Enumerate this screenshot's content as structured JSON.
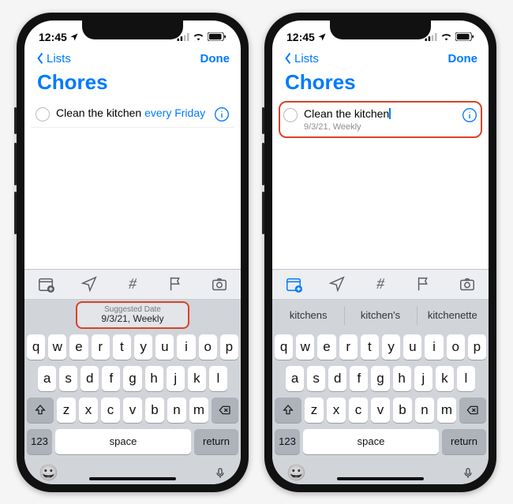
{
  "status": {
    "time": "12:45",
    "has_location_arrow": true
  },
  "nav": {
    "back": "Lists",
    "done": "Done"
  },
  "title": "Chores",
  "left": {
    "reminder_text_plain": "Clean the kitchen ",
    "reminder_text_nl": "every Friday",
    "suggest_label": "Suggested Date",
    "suggest_value": "9/3/21, Weekly"
  },
  "right": {
    "reminder_text": "Clean the kitchen",
    "reminder_sub": "9/3/21, Weekly",
    "predictions": [
      "kitchens",
      "kitchen's",
      "kitchenette"
    ]
  },
  "keyboard": {
    "row1": [
      "q",
      "w",
      "e",
      "r",
      "t",
      "y",
      "u",
      "i",
      "o",
      "p"
    ],
    "row2": [
      "a",
      "s",
      "d",
      "f",
      "g",
      "h",
      "j",
      "k",
      "l"
    ],
    "row3": [
      "z",
      "x",
      "c",
      "v",
      "b",
      "n",
      "m"
    ],
    "num": "123",
    "space": "space",
    "ret": "return"
  },
  "icons": {
    "calendar": "calendar-add-icon",
    "location": "location-arrow-icon",
    "hash": "hash-icon",
    "flag": "flag-icon",
    "camera": "camera-icon",
    "info": "info-icon",
    "shift": "shift-icon",
    "backspace": "backspace-icon",
    "emoji": "emoji-icon",
    "mic": "mic-icon"
  }
}
